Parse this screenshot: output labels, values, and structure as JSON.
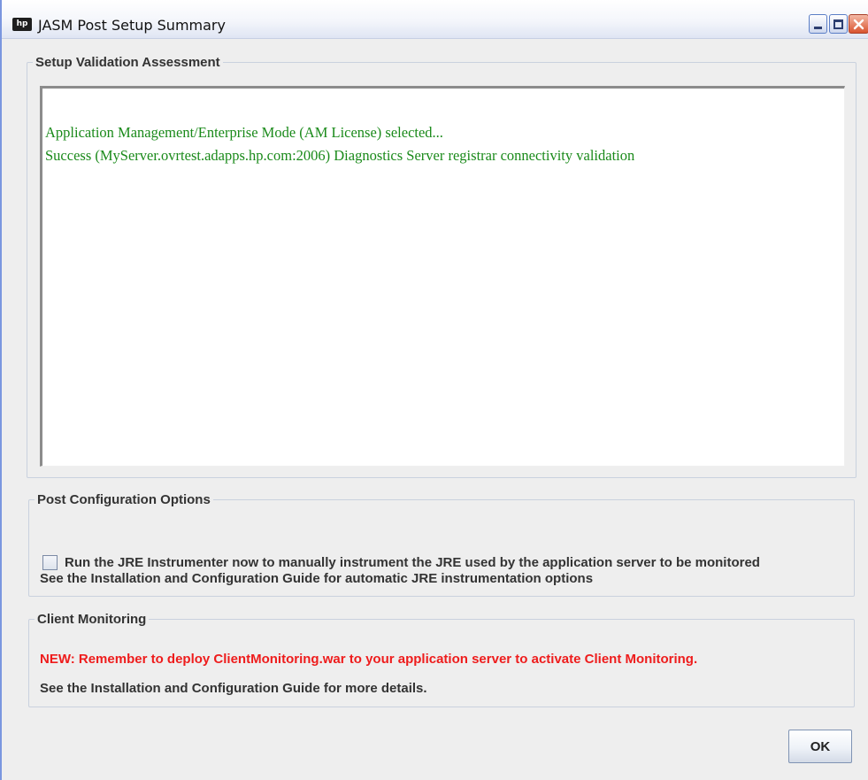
{
  "window": {
    "title": "JASM Post Setup Summary",
    "app_icon_label": "hp",
    "controls": [
      "minimize",
      "maximize",
      "close"
    ]
  },
  "validation": {
    "legend": "Setup Validation Assessment",
    "lines": [
      "Application Management/Enterprise Mode (AM License) selected...",
      "Success (MyServer.ovrtest.adapps.hp.com:2006) Diagnostics Server registrar connectivity validation"
    ],
    "text_color": "#1a8a1a"
  },
  "post_config": {
    "legend": "Post Configuration Options",
    "checkbox_label": "Run the JRE Instrumenter now to manually instrument the JRE used by the application server to be monitored",
    "checkbox_checked": false,
    "guide_text": "See the Installation and Configuration Guide for automatic JRE instrumentation options"
  },
  "client_monitoring": {
    "legend": "Client Monitoring",
    "warning_text": "NEW: Remember to deploy ClientMonitoring.war to your application server to activate Client Monitoring.",
    "warning_color": "#ee1c1c",
    "guide_text": "See the Installation and Configuration Guide for more details."
  },
  "footer": {
    "ok_label": "OK"
  }
}
